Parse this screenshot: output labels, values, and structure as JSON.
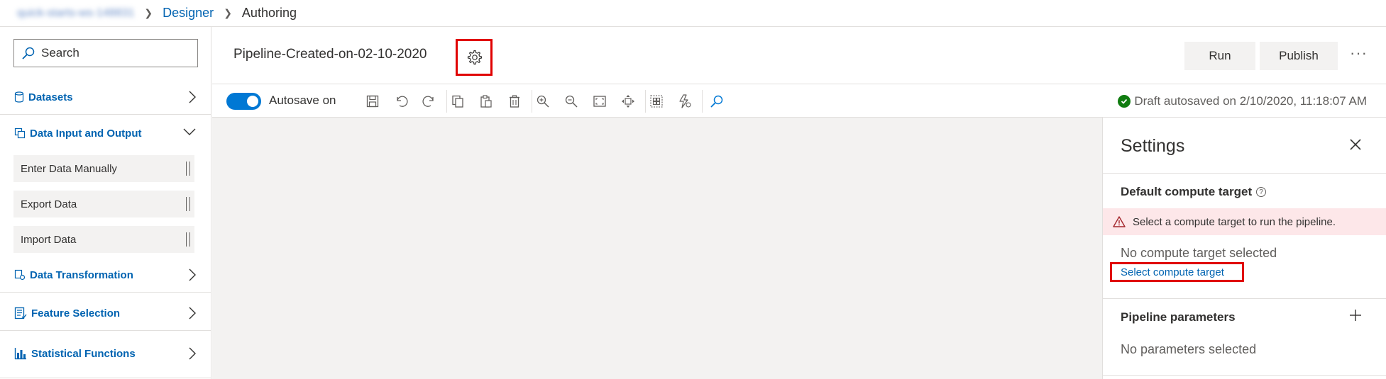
{
  "breadcrumb": {
    "workspace": "quick-starts-ws-148831",
    "designer": "Designer",
    "current": "Authoring"
  },
  "sidebar": {
    "search_placeholder": "Search",
    "categories": [
      {
        "label": "Datasets",
        "icon": "cylinder-icon",
        "expanded": false
      },
      {
        "label": "Data Input and Output",
        "icon": "data-io-icon",
        "expanded": true
      },
      {
        "label": "Data Transformation",
        "icon": "data-transform-icon",
        "expanded": false
      },
      {
        "label": "Feature Selection",
        "icon": "feature-list-icon",
        "expanded": false
      },
      {
        "label": "Statistical Functions",
        "icon": "bar-chart-icon",
        "expanded": false
      }
    ],
    "modules": [
      "Enter Data Manually",
      "Export Data",
      "Import Data"
    ]
  },
  "header": {
    "pipeline_title": "Pipeline-Created-on-02-10-2020",
    "run_label": "Run",
    "publish_label": "Publish",
    "more_label": "···"
  },
  "toolbar": {
    "autosave_label": "Autosave on",
    "autosave_on": true,
    "draft_status": "Draft autosaved on 2/10/2020, 11:18:07 AM"
  },
  "settings": {
    "title": "Settings",
    "compute_title": "Default compute target",
    "warning": "Select a compute target to run the pipeline.",
    "no_compute": "No compute target selected",
    "select_link": "Select compute target",
    "params_title": "Pipeline parameters",
    "no_params": "No parameters selected"
  },
  "colors": {
    "accent": "#0078d4",
    "link": "#0063b1",
    "highlight_box": "#e00000",
    "warning_bg": "#fde7e9",
    "success": "#107c10",
    "canvas_bg": "#f3f2f1"
  }
}
